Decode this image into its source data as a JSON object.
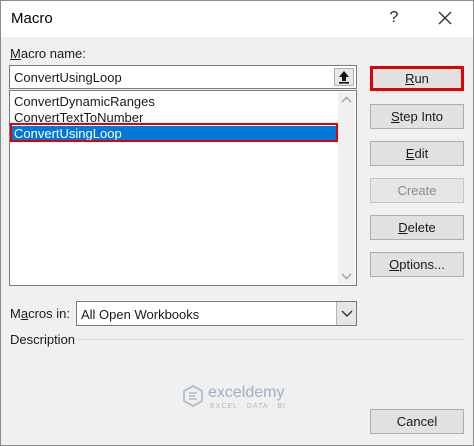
{
  "window": {
    "title": "Macro",
    "help_glyph": "?",
    "close_glyph": "✕"
  },
  "macro_name": {
    "label_prefix": "M",
    "label_rest": "acro name:",
    "value": "ConvertUsingLoop"
  },
  "macro_list": {
    "items": [
      {
        "label": "ConvertDynamicRanges",
        "selected": false
      },
      {
        "label": "ConvertTextToNumber",
        "selected": false
      },
      {
        "label": "ConvertUsingLoop",
        "selected": true
      }
    ]
  },
  "buttons": {
    "run": {
      "mnemonic": "R",
      "rest": "un"
    },
    "step_into": {
      "mnemonic": "S",
      "rest": "tep Into"
    },
    "edit": {
      "mnemonic": "E",
      "rest": "dit"
    },
    "create": {
      "label": "Create",
      "enabled": false
    },
    "delete": {
      "mnemonic": "D",
      "rest": "elete"
    },
    "options": {
      "mnemonic": "O",
      "rest": "ptions..."
    },
    "cancel": {
      "label": "Cancel"
    }
  },
  "macros_in": {
    "label_pre": "M",
    "label_mnemonic": "a",
    "label_rest": "cros in:",
    "value": "All Open Workbooks"
  },
  "description": {
    "label": "Description"
  },
  "watermark": {
    "name": "exceldemy",
    "tagline": "EXCEL · DATA · BI"
  },
  "colors": {
    "highlight_border": "#e30000",
    "selection": "#0078d7"
  }
}
